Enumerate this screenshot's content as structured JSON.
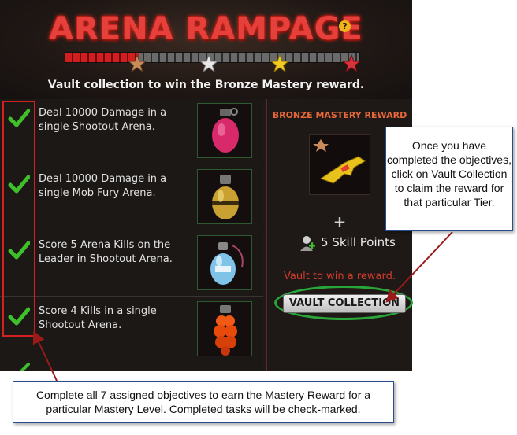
{
  "header": {
    "title": "ARENA RAMPAGE",
    "help_icon": "question-icon",
    "progress_fraction": 0.25,
    "star_colors": [
      "#c98b5a",
      "#e8e8e8",
      "#f2cc22",
      "#d8323a"
    ],
    "message": "Vault collection to win the Bronze Mastery reward."
  },
  "objectives": [
    {
      "text": "Deal 10000 Damage in a single Shootout Arena.",
      "completed": true,
      "reward_icon": "pink-grenade-icon"
    },
    {
      "text": "Deal 10000 Damage in a single Mob Fury Arena.",
      "completed": true,
      "reward_icon": "gold-grenade-icon"
    },
    {
      "text": "Score 5 Arena Kills on the Leader in Shootout Arena.",
      "completed": true,
      "reward_icon": "blue-grenade-icon"
    },
    {
      "text": "Score 4 Kills in a single Shootout Arena.",
      "completed": true,
      "reward_icon": "orange-grenade-icon"
    }
  ],
  "reward": {
    "title": "BRONZE MASTERY REWARD",
    "item_icon": "golden-gun-icon",
    "plus": "+",
    "skill_points": "5 Skill Points",
    "vault_message": "Vault to win a reward.",
    "vault_button": "VAULT COLLECTION"
  },
  "callouts": {
    "right": "Once you have completed the objectives, click on Vault Collection to claim the reward for that particular Tier.",
    "bottom": "Complete all 7 assigned objectives to earn the Mastery Reward for a particular Mastery Level. Completed tasks will be check-marked."
  },
  "colors": {
    "title_red": "#e5403c",
    "reward_title": "#e7683a",
    "vault_msg": "#d43e2c",
    "check_green": "#3fbf2a",
    "highlight_red": "#d42020",
    "ring_green": "#2aa53a"
  }
}
